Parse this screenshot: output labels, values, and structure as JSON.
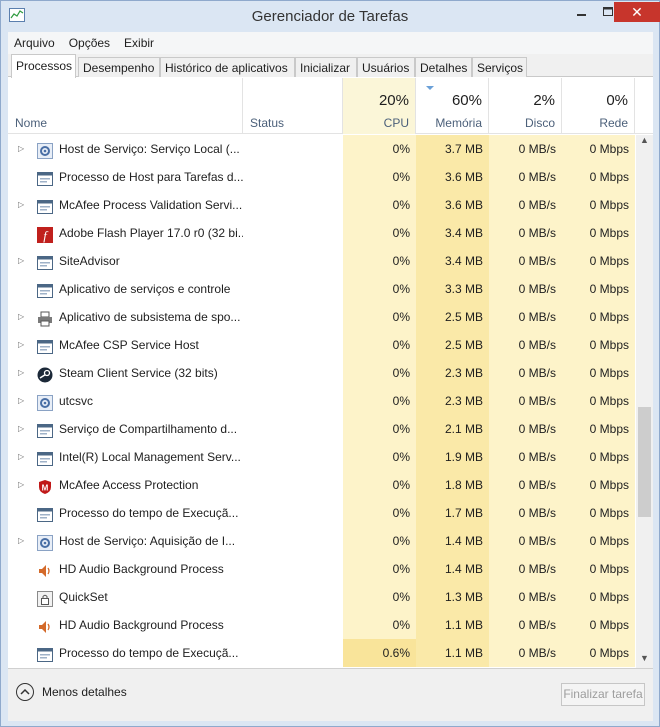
{
  "window": {
    "title": "Gerenciador de Tarefas"
  },
  "menu": [
    "Arquivo",
    "Opções",
    "Exibir"
  ],
  "tabs": [
    "Processos",
    "Desempenho",
    "Histórico de aplicativos",
    "Inicializar",
    "Usuários",
    "Detalhes",
    "Serviços"
  ],
  "active_tab": "Processos",
  "header": {
    "name_label": "Nome",
    "status_label": "Status",
    "cpu_pct": "20%",
    "cpu_label": "CPU",
    "mem_pct": "60%",
    "mem_label": "Memória",
    "disk_pct": "2%",
    "disk_label": "Disco",
    "net_pct": "0%",
    "net_label": "Rede"
  },
  "processes": [
    {
      "name": "Host de Serviço: Serviço Local (...",
      "expandable": true,
      "icon": "gear-icon",
      "cpu": "0%",
      "memory": "3.7 MB",
      "disk": "0 MB/s",
      "network": "0 Mbps"
    },
    {
      "name": "Processo de Host para Tarefas d...",
      "expandable": false,
      "icon": "window-app-icon",
      "cpu": "0%",
      "memory": "3.6 MB",
      "disk": "0 MB/s",
      "network": "0 Mbps"
    },
    {
      "name": "McAfee Process Validation Servi...",
      "expandable": true,
      "icon": "window-app-icon",
      "cpu": "0%",
      "memory": "3.6 MB",
      "disk": "0 MB/s",
      "network": "0 Mbps"
    },
    {
      "name": "Adobe Flash Player 17.0 r0 (32 bi...",
      "expandable": false,
      "icon": "flash-icon",
      "cpu": "0%",
      "memory": "3.4 MB",
      "disk": "0 MB/s",
      "network": "0 Mbps"
    },
    {
      "name": "SiteAdvisor",
      "expandable": true,
      "icon": "window-app-icon",
      "cpu": "0%",
      "memory": "3.4 MB",
      "disk": "0 MB/s",
      "network": "0 Mbps"
    },
    {
      "name": "Aplicativo de serviços e controle",
      "expandable": false,
      "icon": "window-app-icon",
      "cpu": "0%",
      "memory": "3.3 MB",
      "disk": "0 MB/s",
      "network": "0 Mbps"
    },
    {
      "name": "Aplicativo de subsistema de spo...",
      "expandable": true,
      "icon": "printer-icon",
      "cpu": "0%",
      "memory": "2.5 MB",
      "disk": "0 MB/s",
      "network": "0 Mbps"
    },
    {
      "name": "McAfee CSP Service Host",
      "expandable": true,
      "icon": "window-app-icon",
      "cpu": "0%",
      "memory": "2.5 MB",
      "disk": "0 MB/s",
      "network": "0 Mbps"
    },
    {
      "name": "Steam Client Service (32 bits)",
      "expandable": true,
      "icon": "steam-icon",
      "cpu": "0%",
      "memory": "2.3 MB",
      "disk": "0 MB/s",
      "network": "0 Mbps"
    },
    {
      "name": "utcsvc",
      "expandable": true,
      "icon": "gear-icon",
      "cpu": "0%",
      "memory": "2.3 MB",
      "disk": "0 MB/s",
      "network": "0 Mbps"
    },
    {
      "name": "Serviço de Compartilhamento d...",
      "expandable": true,
      "icon": "window-app-icon",
      "cpu": "0%",
      "memory": "2.1 MB",
      "disk": "0 MB/s",
      "network": "0 Mbps"
    },
    {
      "name": "Intel(R) Local Management Serv...",
      "expandable": true,
      "icon": "window-app-icon",
      "cpu": "0%",
      "memory": "1.9 MB",
      "disk": "0 MB/s",
      "network": "0 Mbps"
    },
    {
      "name": "McAfee Access Protection",
      "expandable": true,
      "icon": "mcafee-shield-icon",
      "cpu": "0%",
      "memory": "1.8 MB",
      "disk": "0 MB/s",
      "network": "0 Mbps"
    },
    {
      "name": "Processo do tempo de Execuçã...",
      "expandable": false,
      "icon": "window-app-icon",
      "cpu": "0%",
      "memory": "1.7 MB",
      "disk": "0 MB/s",
      "network": "0 Mbps"
    },
    {
      "name": "Host de Serviço: Aquisição de I...",
      "expandable": true,
      "icon": "gear-icon",
      "cpu": "0%",
      "memory": "1.4 MB",
      "disk": "0 MB/s",
      "network": "0 Mbps"
    },
    {
      "name": "HD Audio Background Process",
      "expandable": false,
      "icon": "speaker-icon",
      "cpu": "0%",
      "memory": "1.4 MB",
      "disk": "0 MB/s",
      "network": "0 Mbps"
    },
    {
      "name": "QuickSet",
      "expandable": false,
      "icon": "lock-app-icon",
      "cpu": "0%",
      "memory": "1.3 MB",
      "disk": "0 MB/s",
      "network": "0 Mbps"
    },
    {
      "name": "HD Audio Background Process",
      "expandable": false,
      "icon": "speaker-icon",
      "cpu": "0%",
      "memory": "1.1 MB",
      "disk": "0 MB/s",
      "network": "0 Mbps"
    },
    {
      "name": "Processo do tempo de Execuçã...",
      "expandable": false,
      "icon": "window-app-icon",
      "cpu": "0.6%",
      "memory": "1.1 MB",
      "disk": "0 MB/s",
      "network": "0 Mbps",
      "cpu_highlight": true
    }
  ],
  "footer": {
    "less_details": "Menos detalhes",
    "end_task": "Finalizar tarefa"
  },
  "colors": {
    "cpu_cell": "#fdf3c9",
    "memory_cell": "#fae9a8",
    "cpu_highlight": "#f9e49a",
    "close_button": "#c7352c",
    "header_label": "#4c607a"
  }
}
